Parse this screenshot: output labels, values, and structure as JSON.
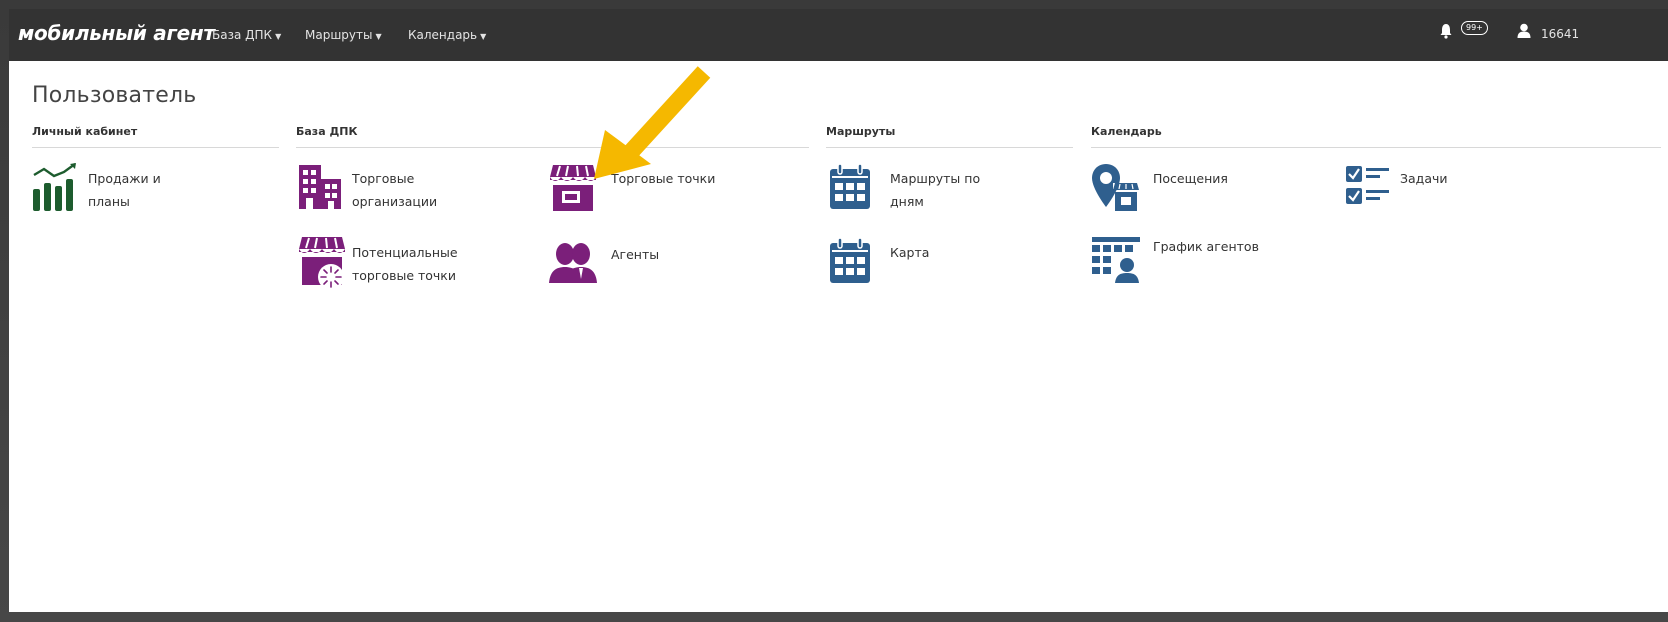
{
  "navbar": {
    "brand": "мобильный агент",
    "menus": [
      {
        "label": "База ДПК"
      },
      {
        "label": "Маршруты"
      },
      {
        "label": "Календарь"
      }
    ],
    "notifications_badge": "99+",
    "user_id": "16641"
  },
  "page": {
    "title": "Пользователь"
  },
  "sections": {
    "personal": {
      "title": "Личный кабинет",
      "items": [
        {
          "label_line1": "Продажи и",
          "label_line2": "планы",
          "icon": "sales-chart-icon"
        }
      ]
    },
    "base": {
      "title": "База ДПК",
      "items": [
        {
          "label_line1": "Торговые",
          "label_line2": "организации",
          "icon": "buildings-icon"
        },
        {
          "label_line1": "Торговые точки",
          "label_line2": "",
          "icon": "storefront-icon"
        },
        {
          "label_line1": "Потенциальные",
          "label_line2": "торговые точки",
          "icon": "potential-store-icon"
        },
        {
          "label_line1": "Агенты",
          "label_line2": "",
          "icon": "agents-icon"
        }
      ]
    },
    "routes": {
      "title": "Маршруты",
      "items": [
        {
          "label_line1": "Маршруты по",
          "label_line2": "дням",
          "icon": "calendar-icon"
        },
        {
          "label_line1": "Карта",
          "label_line2": "",
          "icon": "calendar-map-icon"
        }
      ]
    },
    "calendar": {
      "title": "Календарь",
      "items": [
        {
          "label_line1": "Посещения",
          "label_line2": "",
          "icon": "visit-location-icon"
        },
        {
          "label_line1": "Задачи",
          "label_line2": "",
          "icon": "tasks-checklist-icon"
        },
        {
          "label_line1": "График агентов",
          "label_line2": "",
          "icon": "agent-schedule-icon"
        }
      ]
    }
  },
  "colors": {
    "navbar_bg": "#333333",
    "green": "#1d5c2e",
    "purple": "#7b1f7a",
    "blue": "#2f5f8e",
    "annotation_arrow": "#f5b800"
  }
}
